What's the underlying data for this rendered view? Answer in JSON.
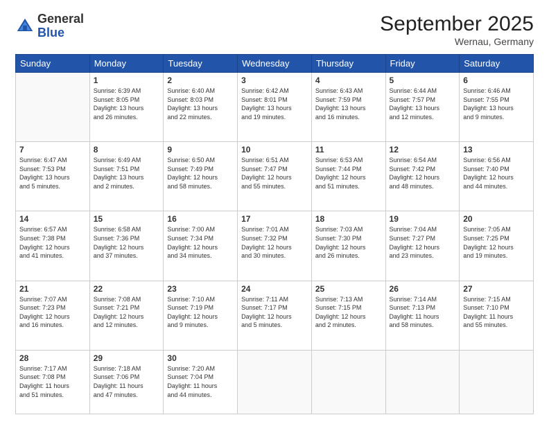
{
  "logo": {
    "general": "General",
    "blue": "Blue"
  },
  "title": "September 2025",
  "location": "Wernau, Germany",
  "headers": [
    "Sunday",
    "Monday",
    "Tuesday",
    "Wednesday",
    "Thursday",
    "Friday",
    "Saturday"
  ],
  "weeks": [
    [
      {
        "day": "",
        "info": ""
      },
      {
        "day": "1",
        "info": "Sunrise: 6:39 AM\nSunset: 8:05 PM\nDaylight: 13 hours\nand 26 minutes."
      },
      {
        "day": "2",
        "info": "Sunrise: 6:40 AM\nSunset: 8:03 PM\nDaylight: 13 hours\nand 22 minutes."
      },
      {
        "day": "3",
        "info": "Sunrise: 6:42 AM\nSunset: 8:01 PM\nDaylight: 13 hours\nand 19 minutes."
      },
      {
        "day": "4",
        "info": "Sunrise: 6:43 AM\nSunset: 7:59 PM\nDaylight: 13 hours\nand 16 minutes."
      },
      {
        "day": "5",
        "info": "Sunrise: 6:44 AM\nSunset: 7:57 PM\nDaylight: 13 hours\nand 12 minutes."
      },
      {
        "day": "6",
        "info": "Sunrise: 6:46 AM\nSunset: 7:55 PM\nDaylight: 13 hours\nand 9 minutes."
      }
    ],
    [
      {
        "day": "7",
        "info": "Sunrise: 6:47 AM\nSunset: 7:53 PM\nDaylight: 13 hours\nand 5 minutes."
      },
      {
        "day": "8",
        "info": "Sunrise: 6:49 AM\nSunset: 7:51 PM\nDaylight: 13 hours\nand 2 minutes."
      },
      {
        "day": "9",
        "info": "Sunrise: 6:50 AM\nSunset: 7:49 PM\nDaylight: 12 hours\nand 58 minutes."
      },
      {
        "day": "10",
        "info": "Sunrise: 6:51 AM\nSunset: 7:47 PM\nDaylight: 12 hours\nand 55 minutes."
      },
      {
        "day": "11",
        "info": "Sunrise: 6:53 AM\nSunset: 7:44 PM\nDaylight: 12 hours\nand 51 minutes."
      },
      {
        "day": "12",
        "info": "Sunrise: 6:54 AM\nSunset: 7:42 PM\nDaylight: 12 hours\nand 48 minutes."
      },
      {
        "day": "13",
        "info": "Sunrise: 6:56 AM\nSunset: 7:40 PM\nDaylight: 12 hours\nand 44 minutes."
      }
    ],
    [
      {
        "day": "14",
        "info": "Sunrise: 6:57 AM\nSunset: 7:38 PM\nDaylight: 12 hours\nand 41 minutes."
      },
      {
        "day": "15",
        "info": "Sunrise: 6:58 AM\nSunset: 7:36 PM\nDaylight: 12 hours\nand 37 minutes."
      },
      {
        "day": "16",
        "info": "Sunrise: 7:00 AM\nSunset: 7:34 PM\nDaylight: 12 hours\nand 34 minutes."
      },
      {
        "day": "17",
        "info": "Sunrise: 7:01 AM\nSunset: 7:32 PM\nDaylight: 12 hours\nand 30 minutes."
      },
      {
        "day": "18",
        "info": "Sunrise: 7:03 AM\nSunset: 7:30 PM\nDaylight: 12 hours\nand 26 minutes."
      },
      {
        "day": "19",
        "info": "Sunrise: 7:04 AM\nSunset: 7:27 PM\nDaylight: 12 hours\nand 23 minutes."
      },
      {
        "day": "20",
        "info": "Sunrise: 7:05 AM\nSunset: 7:25 PM\nDaylight: 12 hours\nand 19 minutes."
      }
    ],
    [
      {
        "day": "21",
        "info": "Sunrise: 7:07 AM\nSunset: 7:23 PM\nDaylight: 12 hours\nand 16 minutes."
      },
      {
        "day": "22",
        "info": "Sunrise: 7:08 AM\nSunset: 7:21 PM\nDaylight: 12 hours\nand 12 minutes."
      },
      {
        "day": "23",
        "info": "Sunrise: 7:10 AM\nSunset: 7:19 PM\nDaylight: 12 hours\nand 9 minutes."
      },
      {
        "day": "24",
        "info": "Sunrise: 7:11 AM\nSunset: 7:17 PM\nDaylight: 12 hours\nand 5 minutes."
      },
      {
        "day": "25",
        "info": "Sunrise: 7:13 AM\nSunset: 7:15 PM\nDaylight: 12 hours\nand 2 minutes."
      },
      {
        "day": "26",
        "info": "Sunrise: 7:14 AM\nSunset: 7:13 PM\nDaylight: 11 hours\nand 58 minutes."
      },
      {
        "day": "27",
        "info": "Sunrise: 7:15 AM\nSunset: 7:10 PM\nDaylight: 11 hours\nand 55 minutes."
      }
    ],
    [
      {
        "day": "28",
        "info": "Sunrise: 7:17 AM\nSunset: 7:08 PM\nDaylight: 11 hours\nand 51 minutes."
      },
      {
        "day": "29",
        "info": "Sunrise: 7:18 AM\nSunset: 7:06 PM\nDaylight: 11 hours\nand 47 minutes."
      },
      {
        "day": "30",
        "info": "Sunrise: 7:20 AM\nSunset: 7:04 PM\nDaylight: 11 hours\nand 44 minutes."
      },
      {
        "day": "",
        "info": ""
      },
      {
        "day": "",
        "info": ""
      },
      {
        "day": "",
        "info": ""
      },
      {
        "day": "",
        "info": ""
      }
    ]
  ]
}
